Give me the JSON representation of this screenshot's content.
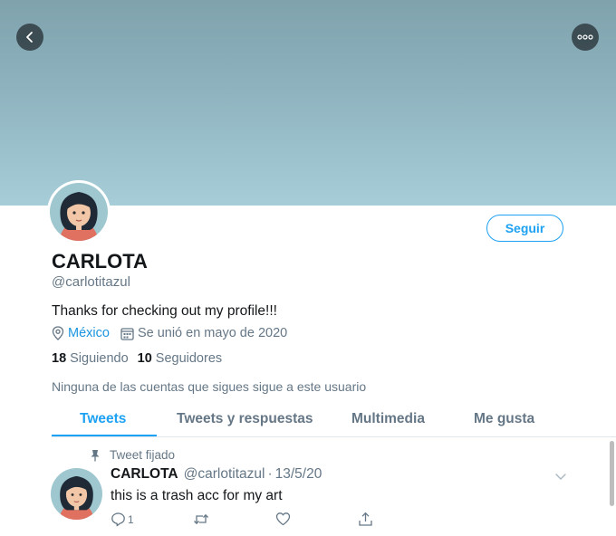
{
  "colors": {
    "accent": "#1da1f2",
    "link": "#1b95e0",
    "muted": "#657786",
    "text": "#14171a"
  },
  "header": {
    "back_icon": "chevron-left-icon",
    "more_icon": "more-horizontal-icon"
  },
  "profile": {
    "name": "CARLOTA",
    "handle": "@carlotitazul",
    "bio": "Thanks for checking out my profile!!!",
    "location": "México",
    "joined": "Se unió en mayo de 2020",
    "following_count": "18",
    "following_label": "Siguiendo",
    "followers_count": "10",
    "followers_label": "Seguidores",
    "follow_button": "Seguir",
    "no_followed_followers": "Ninguna de las cuentas que sigues sigue a este usuario"
  },
  "tabs": [
    {
      "label": "Tweets",
      "active": true
    },
    {
      "label": "Tweets y respuestas",
      "active": false
    },
    {
      "label": "Multimedia",
      "active": false
    },
    {
      "label": "Me gusta",
      "active": false
    }
  ],
  "tweet": {
    "pinned_label": "Tweet fijado",
    "author_name": "CARLOTA",
    "author_handle": "@carlotitazul",
    "separator": "·",
    "date": "13/5/20",
    "text": "this is a trash acc for my art",
    "reply_count": "1"
  }
}
